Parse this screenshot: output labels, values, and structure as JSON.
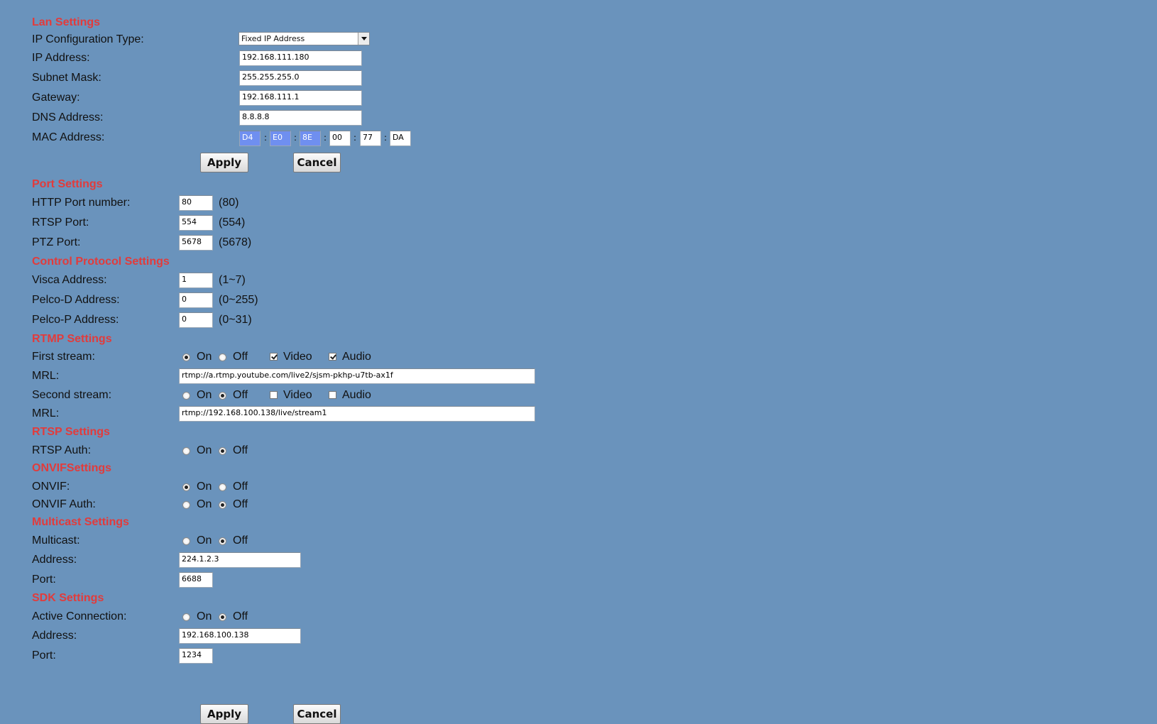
{
  "lan": {
    "title": "Lan Settings",
    "ip_type_label": "IP Configuration Type:",
    "ip_type_value": "Fixed IP Address",
    "ip_label": "IP Address:",
    "ip_value": "192.168.111.180",
    "subnet_label": "Subnet Mask:",
    "subnet_value": "255.255.255.0",
    "gateway_label": "Gateway:",
    "gateway_value": "192.168.111.1",
    "dns_label": "DNS Address:",
    "dns_value": "8.8.8.8",
    "mac_label": "MAC Address:",
    "mac": [
      "D4",
      "E0",
      "8E",
      "00",
      "77",
      "DA"
    ],
    "mac_sep": ":",
    "apply": "Apply",
    "cancel": "Cancel"
  },
  "port": {
    "title": "Port Settings",
    "http_label": "HTTP Port number:",
    "http_value": "80",
    "http_hint": "(80)",
    "rtsp_label": "RTSP Port:",
    "rtsp_value": "554",
    "rtsp_hint": "(554)",
    "ptz_label": "PTZ Port:",
    "ptz_value": "5678",
    "ptz_hint": "(5678)"
  },
  "control": {
    "title": "Control Protocol Settings",
    "visca_label": "Visca Address:",
    "visca_value": "1",
    "visca_hint": "(1~7)",
    "pelcod_label": "Pelco-D Address:",
    "pelcod_value": "0",
    "pelcod_hint": "(0~255)",
    "pelcop_label": "Pelco-P Address:",
    "pelcop_value": "0",
    "pelcop_hint": "(0~31)"
  },
  "rtmp": {
    "title": "RTMP Settings",
    "first_label": "First stream:",
    "first_enabled": "On",
    "mrl_label": "MRL:",
    "first_mrl": "rtmp://a.rtmp.youtube.com/live2/sjsm-pkhp-u7tb-ax1f",
    "second_label": "Second stream:",
    "second_enabled": "Off",
    "second_mrl": "rtmp://192.168.100.138/live/stream1",
    "video": "Video",
    "audio": "Audio",
    "first_video": true,
    "first_audio": true,
    "second_video": false,
    "second_audio": false
  },
  "rtsp": {
    "title": "RTSP Settings",
    "auth_label": "RTSP Auth:",
    "auth_value": "Off"
  },
  "onvif": {
    "title": "ONVIFSettings",
    "onvif_label": "ONVIF:",
    "onvif_value": "On",
    "auth_label": "ONVIF Auth:",
    "auth_value": "Off"
  },
  "multicast": {
    "title": "Multicast Settings",
    "multicast_label": "Multicast:",
    "multicast_value": "Off",
    "address_label": "Address:",
    "address_value": "224.1.2.3",
    "port_label": "Port:",
    "port_value": "6688"
  },
  "sdk": {
    "title": "SDK Settings",
    "active_label": "Active Connection:",
    "active_value": "Off",
    "address_label": "Address:",
    "address_value": "192.168.100.138",
    "port_label": "Port:",
    "port_value": "1234"
  },
  "common": {
    "on": "On",
    "off": "Off"
  },
  "footer": {
    "apply": "Apply",
    "cancel": "Cancel"
  }
}
